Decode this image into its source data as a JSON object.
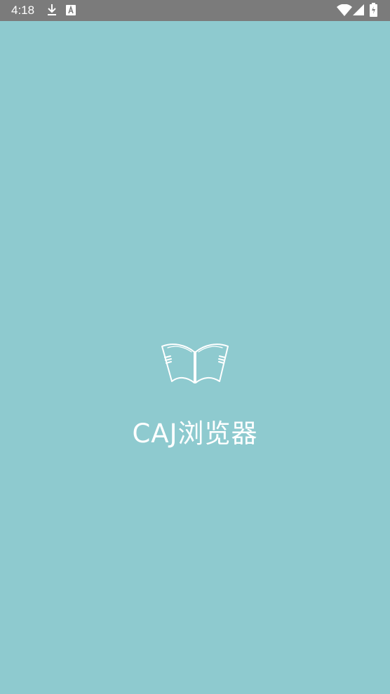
{
  "status_bar": {
    "time": "4:18",
    "icons": [
      "download-icon",
      "font-icon",
      "wifi-icon",
      "signal-icon",
      "battery-icon"
    ]
  },
  "splash": {
    "app_name": "CAJ浏览器",
    "logo_icon": "open-book-icon"
  },
  "colors": {
    "background": "#8ecacf",
    "status_bar": "#7b7b7b",
    "foreground": "#ffffff"
  }
}
